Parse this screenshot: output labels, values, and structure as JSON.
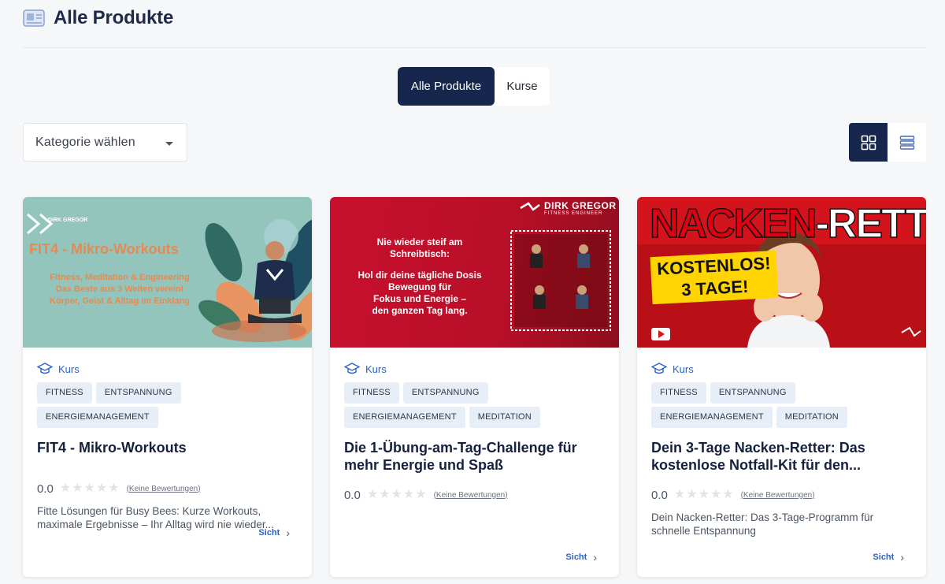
{
  "header": {
    "title": "Alle Produkte",
    "icon": "catalog-icon"
  },
  "tabs": [
    {
      "label": "Alle Produkte",
      "active": true
    },
    {
      "label": "Kurse",
      "active": false
    }
  ],
  "filter": {
    "category_label": "Kategorie wählen"
  },
  "view_toggle": {
    "active": "grid"
  },
  "cards": [
    {
      "type_label": "Kurs",
      "tags": [
        "FITNESS",
        "ENTSPANNUNG",
        "ENERGIEMANAGEMENT"
      ],
      "title": "FIT4 - Mikro-Workouts",
      "score": "0.0",
      "stars": 0,
      "reviews_label": "(Keine Bewertungen)",
      "description": "Fitte Lösungen für Busy Bees: Kurze Workouts, maximale Ergebnisse – Ihr Alltag wird nie wieder...",
      "view_label": "Sicht",
      "image": {
        "logo_text": "DIRK GREGOR",
        "headline": "FIT4 - Mikro-Workouts",
        "lines": [
          "Fitness, Meditation & Engineering",
          "Das Beste aus 3 Welten vereint",
          "Körper, Geist & Alltag im Einklang"
        ]
      }
    },
    {
      "type_label": "Kurs",
      "tags": [
        "FITNESS",
        "ENTSPANNUNG",
        "ENERGIEMANAGEMENT",
        "MEDITATION"
      ],
      "title": "Die 1-Übung-am-Tag-Challenge für mehr Energie und Spaß",
      "score": "0.0",
      "stars": 0,
      "reviews_label": "(Keine Bewertungen)",
      "description": "",
      "view_label": "Sicht",
      "image": {
        "logo_text": "DIRK GREGOR",
        "logo_sub": "FITNESS ENGINEER",
        "lines": [
          "Nie wieder steif am",
          "Schreibtisch:",
          "",
          "Hol dir deine tägliche Dosis",
          "Bewegung für",
          "Fokus und Energie –",
          "den ganzen Tag lang."
        ]
      }
    },
    {
      "type_label": "Kurs",
      "tags": [
        "FITNESS",
        "ENTSPANNUNG",
        "ENERGIEMANAGEMENT",
        "MEDITATION"
      ],
      "title": "Dein 3-Tage Nacken-Retter: Das kostenlose Notfall-Kit für den...",
      "score": "0.0",
      "stars": 0,
      "reviews_label": "(Keine Bewertungen)",
      "description": "Dein Nacken-Retter: Das 3-Tage-Programm für schnelle Entspannung",
      "view_label": "Sicht",
      "image": {
        "headline_a": "NACKEN",
        "headline_b": "-RETTER!",
        "badge_a": "KOSTENLOS!",
        "badge_b": "3 TAGE!"
      }
    }
  ],
  "colors": {
    "navy": "#16264d",
    "accent_blue": "#2b62c7",
    "tag_bg": "#e8eef8",
    "card1_bg": "#93c5bc",
    "card2_bg": "#c8102e",
    "card3_bg": "#d4141c"
  }
}
